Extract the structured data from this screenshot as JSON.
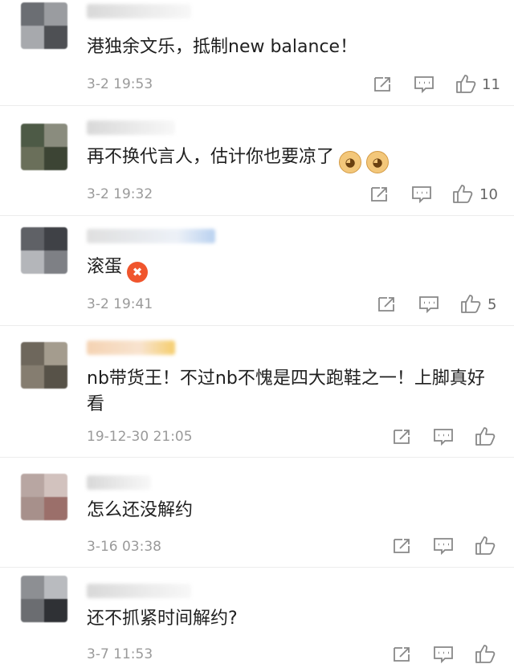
{
  "comments": [
    {
      "text": "港独余文乐，抵制new balance！",
      "time": "3-2 19:53",
      "likes": "11",
      "emojis": []
    },
    {
      "text": "再不换代言人，估计你也要凉了",
      "time": "3-2 19:32",
      "likes": "10",
      "emojis": [
        "dog-emoji",
        "dog-emoji"
      ]
    },
    {
      "text": "滚蛋",
      "time": "3-2 19:41",
      "likes": "5",
      "emojis": [
        "angry-emoji"
      ]
    },
    {
      "text": "nb带货王！不过nb不愧是四大跑鞋之一！上脚真好看",
      "time": "19-12-30 21:05",
      "likes": "",
      "emojis": []
    },
    {
      "text": "怎么还没解约",
      "time": "3-16 03:38",
      "likes": "",
      "emojis": []
    },
    {
      "text": "还不抓紧时间解约?",
      "time": "3-7 11:53",
      "likes": "",
      "emojis": []
    }
  ],
  "icons": {
    "share": "share-icon",
    "reply": "comment-icon",
    "like": "thumbs-up-icon"
  }
}
